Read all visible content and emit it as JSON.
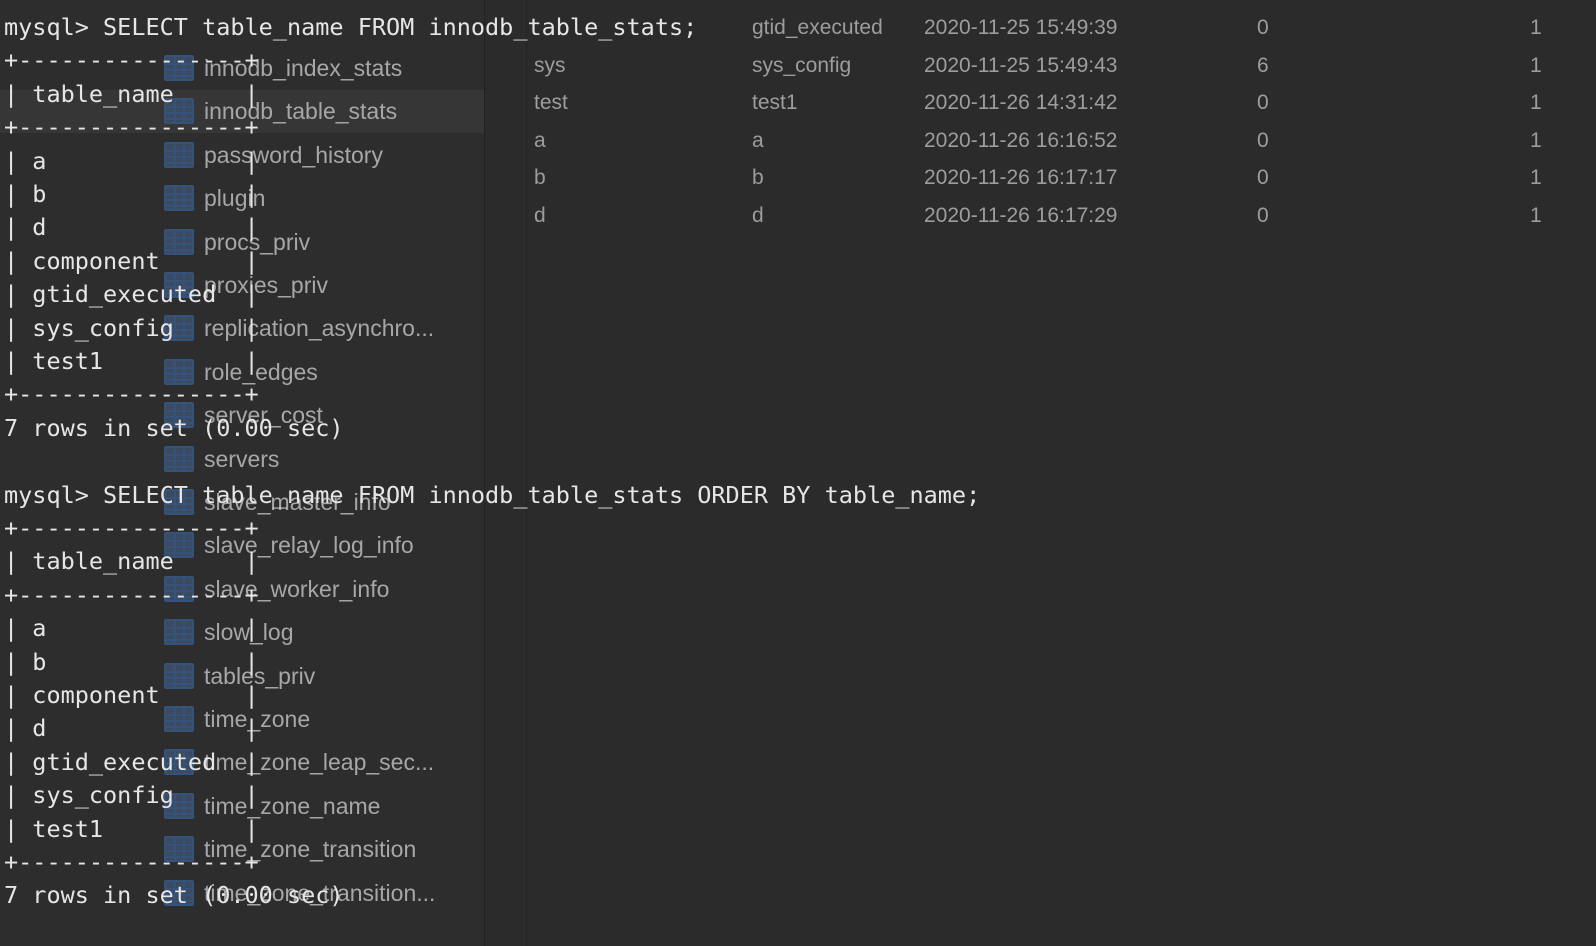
{
  "sidebar": {
    "items": [
      {
        "label": "innodb_index_stats",
        "selected": false
      },
      {
        "label": "innodb_table_stats",
        "selected": true
      },
      {
        "label": "password_history",
        "selected": false
      },
      {
        "label": "plugin",
        "selected": false
      },
      {
        "label": "procs_priv",
        "selected": false
      },
      {
        "label": "proxies_priv",
        "selected": false
      },
      {
        "label": "replication_asynchro...",
        "selected": false
      },
      {
        "label": "role_edges",
        "selected": false
      },
      {
        "label": "server_cost",
        "selected": false
      },
      {
        "label": "servers",
        "selected": false
      },
      {
        "label": "slave_master_info",
        "selected": false
      },
      {
        "label": "slave_relay_log_info",
        "selected": false
      },
      {
        "label": "slave_worker_info",
        "selected": false
      },
      {
        "label": "slow_log",
        "selected": false
      },
      {
        "label": "tables_priv",
        "selected": false
      },
      {
        "label": "time_zone",
        "selected": false
      },
      {
        "label": "time_zone_leap_sec...",
        "selected": false
      },
      {
        "label": "time_zone_name",
        "selected": false
      },
      {
        "label": "time_zone_transition",
        "selected": false
      },
      {
        "label": "time_zone_transition...",
        "selected": false
      }
    ],
    "icon": "table-icon",
    "selected_color": "#363637",
    "icon_color": "#34527a"
  },
  "grid": {
    "rows": [
      [
        "",
        "gtid_executed",
        "2020-11-25 15:49:39",
        "0",
        "1"
      ],
      [
        "sys",
        "sys_config",
        "2020-11-25 15:49:43",
        "6",
        "1"
      ],
      [
        "test",
        "test1",
        "2020-11-26 14:31:42",
        "0",
        "1"
      ],
      [
        "a",
        "a",
        "2020-11-26 16:16:52",
        "0",
        "1"
      ],
      [
        "b",
        "b",
        "2020-11-26 16:17:17",
        "0",
        "1"
      ],
      [
        "d",
        "d",
        "2020-11-26 16:17:29",
        "0",
        "1"
      ]
    ]
  },
  "terminal": {
    "text_color": "#e6e6e6",
    "lines": [
      "mysql> SELECT table_name FROM innodb_table_stats;",
      "+----------------+",
      "| table_name     |",
      "+----------------+",
      "| a              |",
      "| b              |",
      "| d              |",
      "| component      |",
      "| gtid_executed  |",
      "| sys_config     |",
      "| test1          |",
      "+----------------+",
      "7 rows in set (0.00 sec)",
      "",
      "mysql> SELECT table_name FROM innodb_table_stats ORDER BY table_name;",
      "+----------------+",
      "| table_name     |",
      "+----------------+",
      "| a              |",
      "| b              |",
      "| component      |",
      "| d              |",
      "| gtid_executed  |",
      "| sys_config     |",
      "| test1          |",
      "+----------------+",
      "7 rows in set (0.00 sec)"
    ]
  }
}
